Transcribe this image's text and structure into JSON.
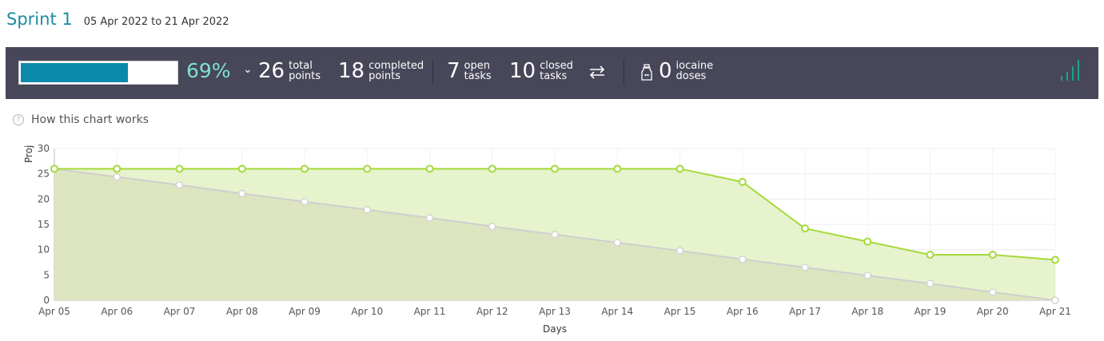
{
  "sprint": {
    "title": "Sprint 1",
    "start_date": "05 Apr 2022",
    "separator": "to",
    "end_date": "21 Apr 2022"
  },
  "stats": {
    "progress_percent": 69,
    "progress_label": "69%",
    "total_points": "26",
    "total_points_label": [
      "total",
      "points"
    ],
    "completed_points": "18",
    "completed_points_label": [
      "completed",
      "points"
    ],
    "open_tasks": "7",
    "open_tasks_label": [
      "open",
      "tasks"
    ],
    "closed_tasks": "10",
    "closed_tasks_label": [
      "closed",
      "tasks"
    ],
    "iocaine_doses": "0",
    "iocaine_label": [
      "iocaine",
      "doses"
    ]
  },
  "help": {
    "label": "How this chart works"
  },
  "colors": {
    "accent": "#1d8aa0",
    "progress": "#0a89a8",
    "percent": "#7ee0d2",
    "bar_bg": "#474759",
    "real_line": "#a6d93b",
    "ideal_line": "#cfcfcf"
  },
  "chart_data": {
    "type": "area",
    "xlabel": "Days",
    "ylabel": "Projected points",
    "ylim": [
      0,
      30
    ],
    "yticks": [
      0,
      5,
      10,
      15,
      20,
      25,
      30
    ],
    "grid": true,
    "categories": [
      "Apr 05",
      "Apr 06",
      "Apr 07",
      "Apr 08",
      "Apr 09",
      "Apr 10",
      "Apr 11",
      "Apr 12",
      "Apr 13",
      "Apr 14",
      "Apr 15",
      "Apr 16",
      "Apr 17",
      "Apr 18",
      "Apr 19",
      "Apr 20",
      "Apr 21"
    ],
    "series": [
      {
        "key": "ideal",
        "values": [
          26,
          24.4,
          22.8,
          21.1,
          19.5,
          17.9,
          16.3,
          14.6,
          13.0,
          11.4,
          9.8,
          8.1,
          6.5,
          4.9,
          3.3,
          1.6,
          0
        ]
      },
      {
        "key": "real",
        "values": [
          26,
          26,
          26,
          26,
          26,
          26,
          26,
          26,
          26,
          26,
          26,
          23.4,
          14.2,
          11.6,
          9,
          9,
          8
        ]
      }
    ]
  }
}
